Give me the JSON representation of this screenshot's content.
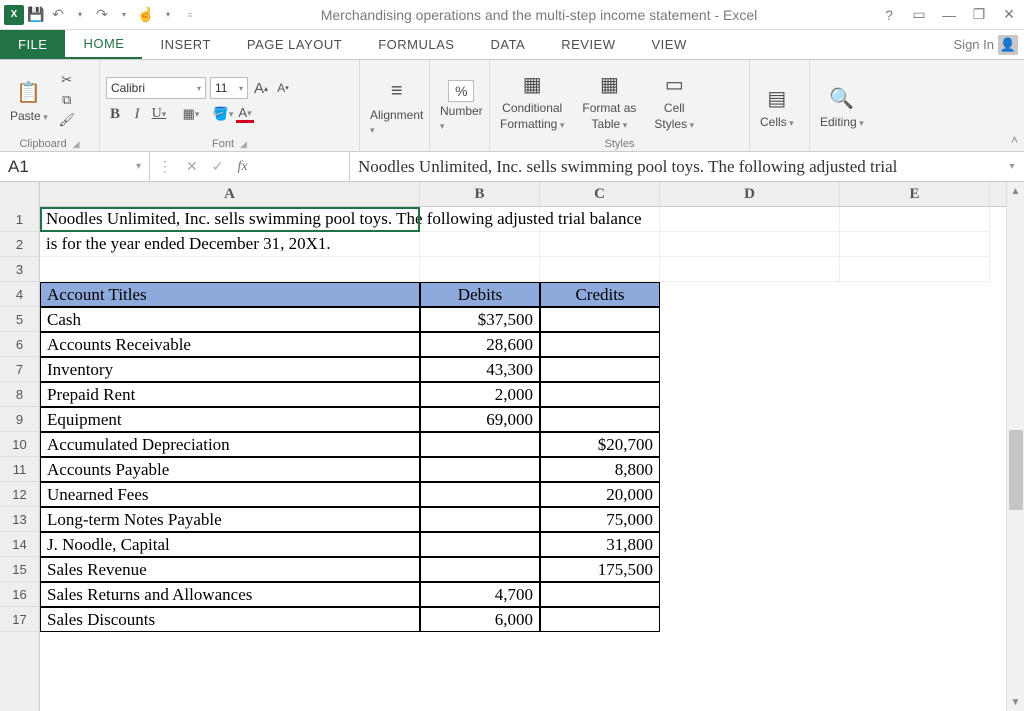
{
  "titlebar": {
    "title": "Merchandising operations and the multi-step income statement - Excel",
    "help": "?"
  },
  "tabs": {
    "file": "FILE",
    "items": [
      "HOME",
      "INSERT",
      "PAGE LAYOUT",
      "FORMULAS",
      "DATA",
      "REVIEW",
      "VIEW"
    ],
    "active": "HOME",
    "signin": "Sign In"
  },
  "ribbon": {
    "clipboard": {
      "label": "Clipboard",
      "paste": "Paste"
    },
    "font": {
      "label": "Font",
      "name": "Calibri",
      "size": "11",
      "increase": "A",
      "decrease": "A"
    },
    "alignment": {
      "label": "Alignment"
    },
    "number": {
      "label": "Number",
      "pct": "%"
    },
    "styles": {
      "label": "Styles",
      "cond": "Conditional",
      "cond2": "Formatting",
      "fmt": "Format as",
      "fmt2": "Table",
      "cell": "Cell",
      "cell2": "Styles"
    },
    "cells": {
      "label": "Cells"
    },
    "editing": {
      "label": "Editing"
    }
  },
  "formula": {
    "namebox": "A1",
    "text": "Noodles Unlimited, Inc. sells swimming pool toys.  The following adjusted trial"
  },
  "columns": [
    "A",
    "B",
    "C",
    "D",
    "E"
  ],
  "rows": [
    "1",
    "2",
    "3",
    "4",
    "5",
    "6",
    "7",
    "8",
    "9",
    "10",
    "11",
    "12",
    "13",
    "14",
    "15",
    "16",
    "17"
  ],
  "sheet": {
    "r1": "Noodles Unlimited, Inc. sells swimming pool toys.  The following adjusted trial balance",
    "r2": "is for the year ended December 31, 20X1."
  },
  "table": {
    "headers": {
      "a": "Account Titles",
      "b": "Debits",
      "c": "Credits"
    },
    "rows": [
      {
        "a": "Cash",
        "b": "$37,500",
        "c": ""
      },
      {
        "a": "Accounts Receivable",
        "b": "28,600",
        "c": ""
      },
      {
        "a": "Inventory",
        "b": "43,300",
        "c": ""
      },
      {
        "a": "Prepaid Rent",
        "b": "2,000",
        "c": ""
      },
      {
        "a": "Equipment",
        "b": "69,000",
        "c": ""
      },
      {
        "a": "Accumulated Depreciation",
        "b": "",
        "c": "$20,700"
      },
      {
        "a": "Accounts Payable",
        "b": "",
        "c": "8,800"
      },
      {
        "a": "Unearned Fees",
        "b": "",
        "c": "20,000"
      },
      {
        "a": "Long-term Notes Payable",
        "b": "",
        "c": "75,000"
      },
      {
        "a": "J. Noodle, Capital",
        "b": "",
        "c": "31,800"
      },
      {
        "a": "Sales Revenue",
        "b": "",
        "c": "175,500"
      },
      {
        "a": "Sales Returns and Allowances",
        "b": "4,700",
        "c": ""
      },
      {
        "a": "Sales Discounts",
        "b": "6,000",
        "c": ""
      }
    ]
  }
}
